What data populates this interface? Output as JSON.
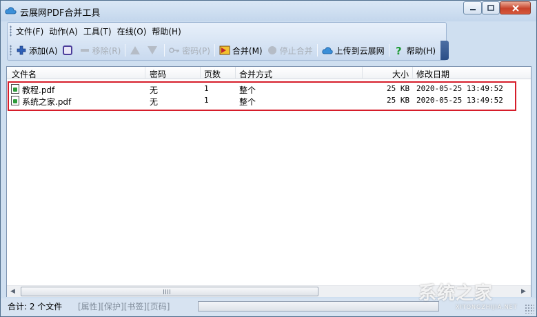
{
  "window": {
    "title": "云展网PDF合并工具"
  },
  "menu": [
    {
      "id": "file",
      "label": "文件(F)"
    },
    {
      "id": "action",
      "label": "动作(A)"
    },
    {
      "id": "tools",
      "label": "工具(T)"
    },
    {
      "id": "online",
      "label": "在线(O)"
    },
    {
      "id": "help",
      "label": "帮助(H)"
    }
  ],
  "toolbar": {
    "add": "添加(A)",
    "remove": "移除(R)",
    "password": "密码(P)",
    "merge": "合并(M)",
    "stop_merge": "停止合并",
    "upload": "上传到云展网",
    "help": "帮助(H)"
  },
  "columns": {
    "name": "文件名",
    "password": "密码",
    "pages": "页数",
    "merge_mode": "合并方式",
    "size": "大小",
    "modified": "修改日期"
  },
  "rows": [
    {
      "name": "教程.pdf",
      "password": "无",
      "pages": "1",
      "merge_mode": "整个",
      "size": "25 KB",
      "modified": "2020-05-25 13:49:52"
    },
    {
      "name": "系统之家.pdf",
      "password": "无",
      "pages": "1",
      "merge_mode": "整个",
      "size": "25 KB",
      "modified": "2020-05-25 13:49:52"
    }
  ],
  "status": {
    "total": "合计: 2 个文件",
    "links": "[属性][保护][书签][页码]"
  },
  "watermark": {
    "main": "系统之家",
    "sub": "XITONGZHIJIA.NET"
  },
  "colors": {
    "highlight": "#d61d2a",
    "titlebar": "#c3d6ec"
  }
}
